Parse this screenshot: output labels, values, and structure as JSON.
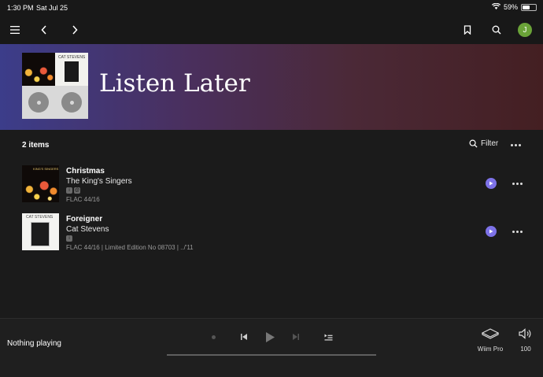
{
  "status_bar": {
    "time": "1:30 PM",
    "date": "Sat Jul 25",
    "battery": "59%",
    "battery_level": 0.59
  },
  "nav": {
    "avatar_initial": "J",
    "icons": [
      "menu-icon",
      "back-icon",
      "forward-icon",
      "bookmark-icon",
      "search-icon"
    ]
  },
  "hero": {
    "title": "Listen Later",
    "art_text": "CAT STEVENS"
  },
  "list": {
    "count": "2 items",
    "filter_label": "Filter",
    "items": [
      {
        "title": "Christmas",
        "artist": "The King's Singers",
        "badges": [
          "i",
          "@"
        ],
        "meta": "FLAC 44/16",
        "art_text": "KING'S SINGERS"
      },
      {
        "title": "Foreigner",
        "artist": "Cat Stevens",
        "badges": [
          "i"
        ],
        "meta": "FLAC 44/16 | Limited Edition No 08703 | ../'11",
        "art_text": "CAT STEVENS"
      }
    ]
  },
  "player": {
    "now_playing": "Nothing playing",
    "zone": "Wiim Pro",
    "volume": "100",
    "progress": 0
  },
  "colors": {
    "accent": "#7d72e8",
    "avatar": "#6aa338",
    "background": "#1b1b1b"
  }
}
